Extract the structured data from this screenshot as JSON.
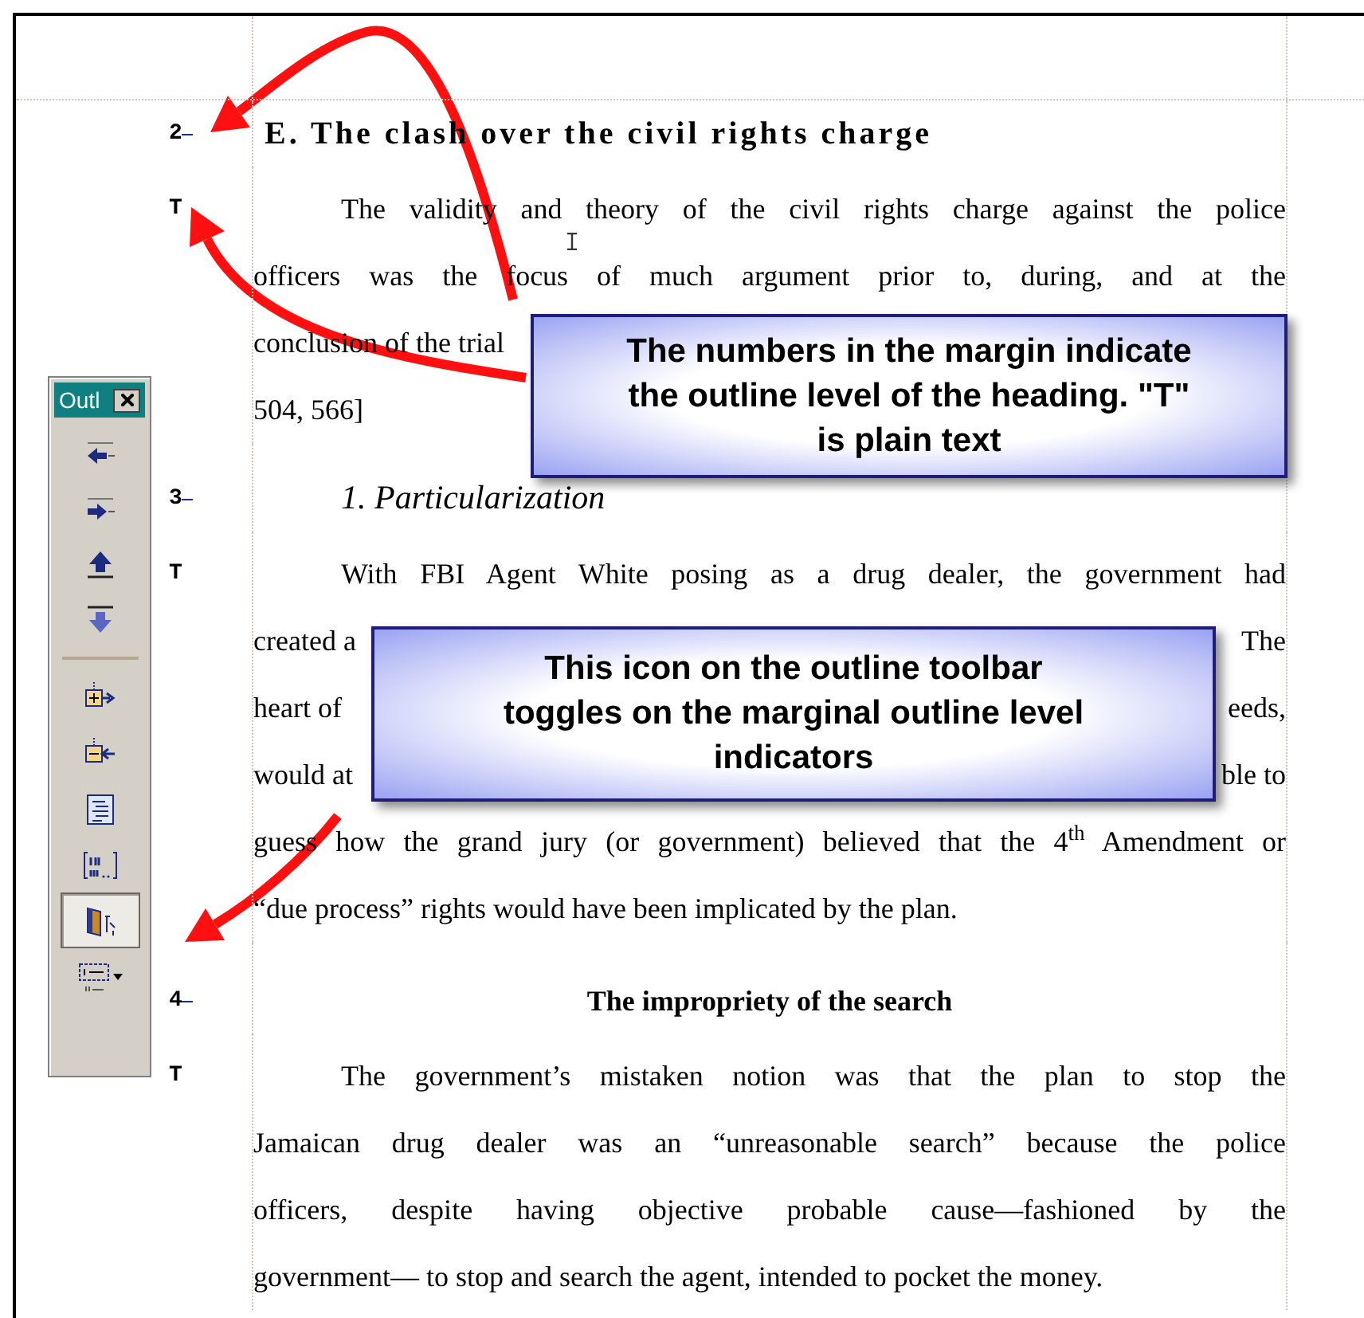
{
  "toolbar": {
    "title": "Outl",
    "buttons": [
      {
        "kind": "promote",
        "pressed": false
      },
      {
        "kind": "demote",
        "pressed": false
      },
      {
        "kind": "move_up",
        "pressed": false
      },
      {
        "kind": "move_down",
        "pressed": false
      },
      {
        "kind": "expand",
        "pressed": false
      },
      {
        "kind": "collapse",
        "pressed": false
      },
      {
        "kind": "show_formatting",
        "pressed": false
      },
      {
        "kind": "numbering",
        "pressed": false
      },
      {
        "kind": "level_indicators",
        "pressed": true
      },
      {
        "kind": "style_dropdown",
        "pressed": false
      }
    ]
  },
  "document": {
    "blocks": [
      {
        "kind": "section",
        "marker": "2",
        "lines": [
          [
            "E.  The clash over the civil rights charge"
          ]
        ]
      },
      {
        "kind": "paragraph",
        "marker": "T",
        "lines": [
          [
            "The validity and theory of the civil rights charge against the police"
          ],
          [
            "officers was the focus of much argument prior to, during, and at the"
          ],
          [
            "conclusion of the trial"
          ],
          [
            "504, 566]"
          ]
        ]
      },
      {
        "kind": "subsection",
        "marker": "3",
        "lines": [
          [
            "1.  Particularization"
          ]
        ]
      },
      {
        "kind": "paragraph",
        "marker": "T",
        "lines": [
          [
            "With FBI Agent White posing as a drug dealer, the government had"
          ],
          [
            "created a",
            "The"
          ],
          [
            "heart of",
            "eeds,"
          ],
          [
            "would at",
            "ble to"
          ],
          [
            "guess how the grand jury (or government) believed that the 4$^{th}$ Amendment or"
          ],
          [
            "“due process” rights would have been implicated by the plan."
          ]
        ]
      },
      {
        "kind": "centered",
        "marker": "4",
        "lines": [
          [
            "The impropriety of the search"
          ]
        ]
      },
      {
        "kind": "paragraph",
        "marker": "T",
        "lines": [
          [
            "The government’s mistaken notion was that the plan to stop the"
          ],
          [
            "Jamaican drug dealer was an “unreasonable search” because the police"
          ],
          [
            "officers, despite having objective probable cause—fashioned by the"
          ],
          [
            "government— to stop and search the agent, intended to pocket the money."
          ]
        ]
      }
    ]
  },
  "callouts": [
    {
      "text": "The numbers in the margin indicate the outline level of the heading.  \"T\" is plain text"
    },
    {
      "text": "This icon on the outline toolbar toggles on the marginal outline level indicators"
    }
  ]
}
